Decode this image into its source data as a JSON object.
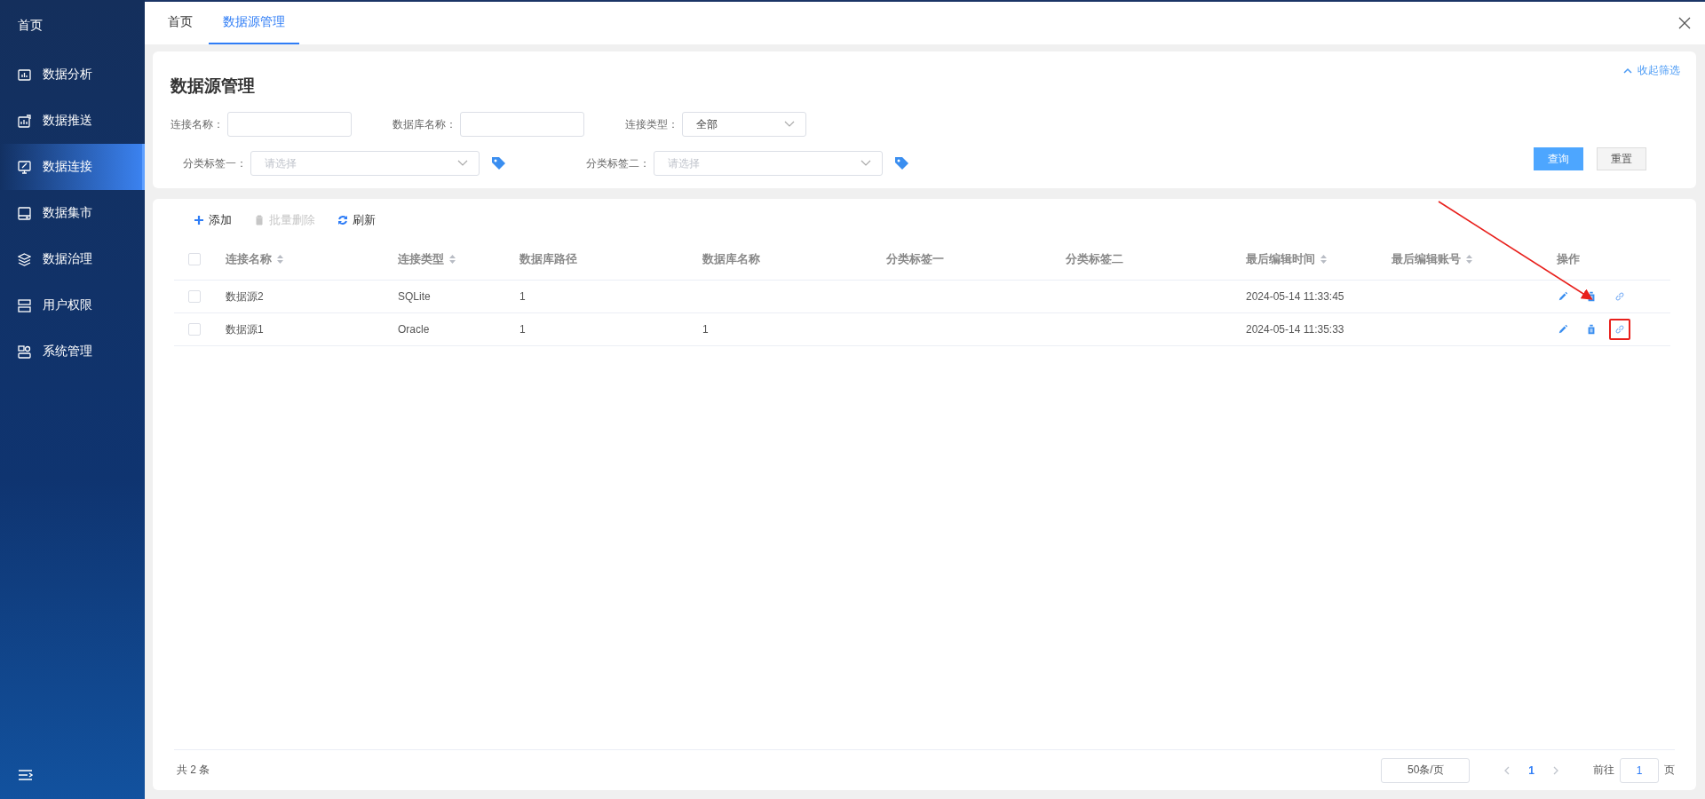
{
  "sidebar": {
    "home": "首页",
    "items": [
      {
        "label": "数据分析",
        "selected": false
      },
      {
        "label": "数据推送",
        "selected": false
      },
      {
        "label": "数据连接",
        "selected": true
      },
      {
        "label": "数据集市",
        "selected": false
      },
      {
        "label": "数据治理",
        "selected": false
      },
      {
        "label": "用户权限",
        "selected": false
      },
      {
        "label": "系统管理",
        "selected": false
      }
    ]
  },
  "tabs": [
    {
      "label": "首页",
      "selected": false
    },
    {
      "label": "数据源管理",
      "selected": true
    }
  ],
  "filter": {
    "title": "数据源管理",
    "collapse": "收起筛选",
    "fields": [
      {
        "label": "连接名称：",
        "kind": "input"
      },
      {
        "label": "数据库名称：",
        "kind": "input"
      },
      {
        "label": "连接类型：",
        "kind": "select",
        "value": "全部"
      }
    ],
    "tags": [
      {
        "label": "分类标签一：",
        "placeholder": "请选择"
      },
      {
        "label": "分类标签二：",
        "placeholder": "请选择"
      }
    ],
    "buttons": [
      {
        "label": "查询",
        "kind": "primary"
      },
      {
        "label": "重置",
        "kind": "default"
      }
    ]
  },
  "toolbar": [
    {
      "label": "添加",
      "disabled": false
    },
    {
      "label": "批量删除",
      "disabled": true
    },
    {
      "label": "刷新",
      "disabled": false
    }
  ],
  "table": {
    "select_all_checked": false,
    "columns": [
      {
        "label": "连接名称",
        "sortable": true
      },
      {
        "label": "连接类型",
        "sortable": true
      },
      {
        "label": "数据库路径",
        "sortable": false
      },
      {
        "label": "数据库名称",
        "sortable": false
      },
      {
        "label": "分类标签一",
        "sortable": false
      },
      {
        "label": "分类标签二",
        "sortable": false
      },
      {
        "label": "最后编辑时间",
        "sortable": true
      },
      {
        "label": "最后编辑账号",
        "sortable": true
      },
      {
        "label": "操作",
        "sortable": false
      }
    ],
    "rows": [
      {
        "checked": false,
        "cells": [
          "数据源2",
          "SQLite",
          "1",
          "",
          "",
          "",
          "2024-05-14 11:33:45",
          ""
        ],
        "actions": [
          {
            "kind": "edit",
            "highlighted": false
          },
          {
            "kind": "delete",
            "highlighted": false
          },
          {
            "kind": "link",
            "highlighted": false
          }
        ]
      },
      {
        "checked": false,
        "cells": [
          "数据源1",
          "Oracle",
          "1",
          "1",
          "",
          "",
          "2024-05-14 11:35:33",
          ""
        ],
        "actions": [
          {
            "kind": "edit",
            "highlighted": false
          },
          {
            "kind": "delete",
            "highlighted": false
          },
          {
            "kind": "link",
            "highlighted": true
          }
        ]
      }
    ]
  },
  "pagination": {
    "total": "共 2 条",
    "page_size": "50条/页",
    "pages": [
      {
        "label": "1",
        "selected": true
      }
    ],
    "goto_label": "前往",
    "goto_value": "1",
    "goto_suffix": "页"
  }
}
